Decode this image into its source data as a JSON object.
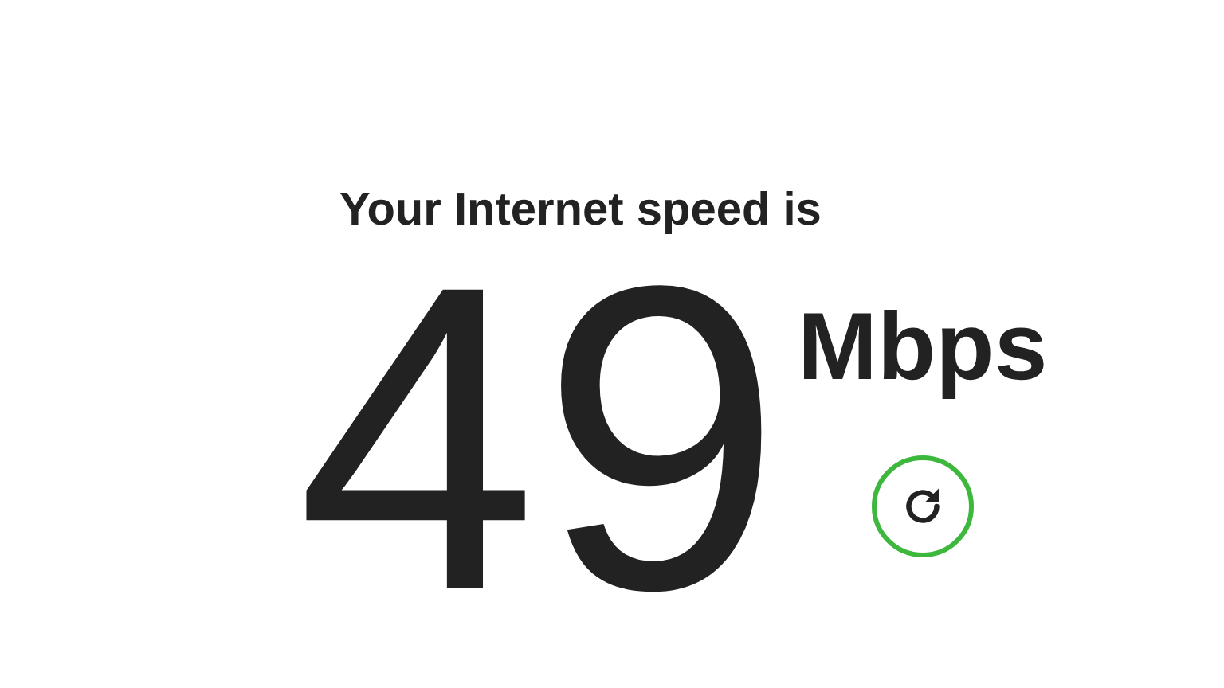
{
  "heading": "Your Internet speed is",
  "speed": {
    "value": "49",
    "unit": "Mbps"
  }
}
